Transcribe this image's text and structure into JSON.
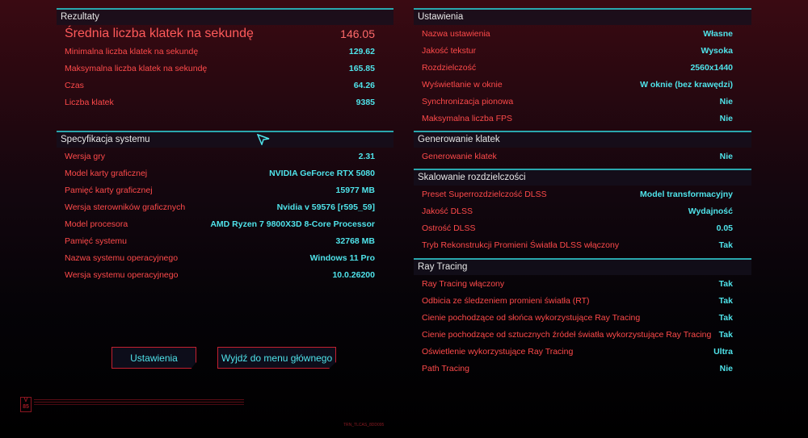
{
  "left": [
    {
      "title": "Rezultaty",
      "rows": [
        {
          "label": "Średnia liczba klatek na sekundę",
          "value": "146.05",
          "big": true
        },
        {
          "label": "Minimalna liczba klatek na sekundę",
          "value": "129.62"
        },
        {
          "label": "Maksymalna liczba klatek na sekundę",
          "value": "165.85"
        },
        {
          "label": "Czas",
          "value": "64.26"
        },
        {
          "label": "Liczba klatek",
          "value": "9385"
        }
      ]
    },
    {
      "title": "Specyfikacja systemu",
      "rows": [
        {
          "label": "Wersja gry",
          "value": "2.31"
        },
        {
          "label": "Model karty graficznej",
          "value": "NVIDIA GeForce RTX 5080"
        },
        {
          "label": "Pamięć karty graficznej",
          "value": "15977 MB"
        },
        {
          "label": "Wersja sterowników graficznych",
          "value": "Nvidia v 59576 [r595_59]"
        },
        {
          "label": "Model procesora",
          "value": "AMD Ryzen 7 9800X3D 8-Core Processor"
        },
        {
          "label": "Pamięć systemu",
          "value": "32768 MB"
        },
        {
          "label": "Nazwa systemu operacyjnego",
          "value": "Windows 11 Pro"
        },
        {
          "label": "Wersja systemu operacyjnego",
          "value": "10.0.26200"
        }
      ]
    }
  ],
  "right": [
    {
      "title": "Ustawienia",
      "rows": [
        {
          "label": "Nazwa ustawienia",
          "value": "Własne"
        },
        {
          "label": "Jakość tekstur",
          "value": "Wysoka"
        },
        {
          "label": "Rozdzielczość",
          "value": "2560x1440"
        },
        {
          "label": "Wyświetlanie w oknie",
          "value": "W oknie (bez krawędzi)"
        },
        {
          "label": "Synchronizacja pionowa",
          "value": "Nie"
        },
        {
          "label": "Maksymalna liczba FPS",
          "value": "Nie"
        }
      ]
    },
    {
      "title": "Generowanie klatek",
      "rows": [
        {
          "label": "Generowanie klatek",
          "value": "Nie"
        }
      ]
    },
    {
      "title": "Skalowanie rozdzielczości",
      "rows": [
        {
          "label": "Preset Superrozdzielczość DLSS",
          "value": "Model transformacyjny"
        },
        {
          "label": "Jakość DLSS",
          "value": "Wydajność"
        },
        {
          "label": "Ostrość DLSS",
          "value": "0.05"
        },
        {
          "label": "Tryb Rekonstrukcji Promieni Światła DLSS włączony",
          "value": "Tak"
        }
      ]
    },
    {
      "title": "Ray Tracing",
      "rows": [
        {
          "label": "Ray Tracing włączony",
          "value": "Tak"
        },
        {
          "label": "Odbicia ze śledzeniem promieni światła (RT)",
          "value": "Tak"
        },
        {
          "label": "Cienie pochodzące od słońca wykorzystujące Ray Tracing",
          "value": "Tak"
        },
        {
          "label": "Cienie pochodzące od sztucznych źródeł światła wykorzystujące Ray Tracing",
          "value": "Tak"
        },
        {
          "label": "Oświetlenie wykorzystujące Ray Tracing",
          "value": "Ultra"
        },
        {
          "label": "Path Tracing",
          "value": "Nie"
        }
      ]
    }
  ],
  "buttons": {
    "settings": "Ustawienia",
    "exit": "Wyjdź do menu głównego"
  },
  "footer": {
    "badge": "V 85",
    "tag": "TRN_TLCAS_8DD095"
  },
  "colors": {
    "label": "#ff4a4a",
    "value": "#4fe3ea",
    "accent_line": "#2aa7ad",
    "button_border": "#c42030"
  }
}
